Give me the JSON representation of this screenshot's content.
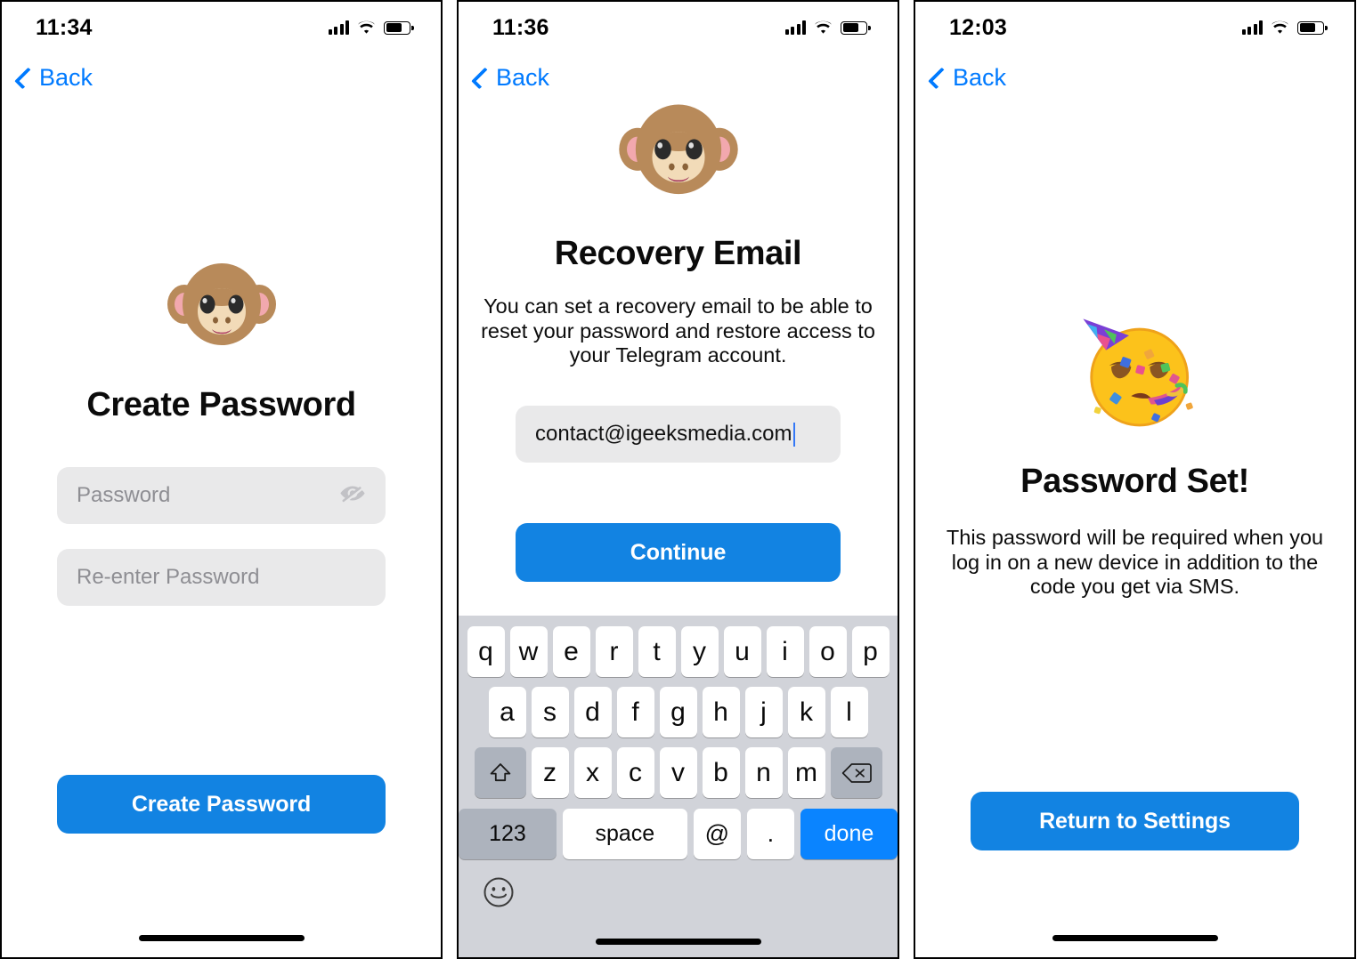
{
  "panels": [
    {
      "status": {
        "time": "11:34",
        "signal_icon": "cellular-signal-icon",
        "wifi_icon": "wifi-icon",
        "battery_icon": "battery-icon"
      },
      "back_label": "Back",
      "emoji": "monkey-face",
      "title": "Create Password",
      "fields": [
        {
          "name": "password-input",
          "placeholder": "Password",
          "value": "",
          "trailing_icon": "eye-slash-icon"
        },
        {
          "name": "reenter-password-input",
          "placeholder": "Re-enter Password",
          "value": "",
          "trailing_icon": ""
        }
      ],
      "button_label": "Create Password"
    },
    {
      "status": {
        "time": "11:36",
        "signal_icon": "cellular-signal-icon",
        "wifi_icon": "wifi-icon",
        "battery_icon": "battery-icon"
      },
      "back_label": "Back",
      "emoji": "monkey-face",
      "title": "Recovery Email",
      "subtitle": "You can set a recovery email to be able to reset your password and restore access to your Telegram account.",
      "email_value": "contact@igeeksmedia.com",
      "button_label": "Continue",
      "keyboard": {
        "row1": [
          "q",
          "w",
          "e",
          "r",
          "t",
          "y",
          "u",
          "i",
          "o",
          "p"
        ],
        "row2": [
          "a",
          "s",
          "d",
          "f",
          "g",
          "h",
          "j",
          "k",
          "l"
        ],
        "row3": [
          "z",
          "x",
          "c",
          "v",
          "b",
          "n",
          "m"
        ],
        "shift_icon": "shift-arrow-icon",
        "delete_icon": "backspace-icon",
        "numbers_label": "123",
        "space_label": "space",
        "at_label": "@",
        "dot_label": ".",
        "done_label": "done",
        "emoji_icon": "smiley-face-icon"
      }
    },
    {
      "status": {
        "time": "12:03",
        "signal_icon": "cellular-signal-icon",
        "wifi_icon": "wifi-icon",
        "battery_icon": "battery-icon"
      },
      "back_label": "Back",
      "emoji": "partying-face",
      "title": "Password Set!",
      "subtitle": "This password will be required when you log in on a new device in addition to the code you get via SMS.",
      "button_label": "Return to Settings"
    }
  ],
  "colors": {
    "accent_blue": "#1283e2",
    "link_blue": "#007AFF",
    "field_gray": "#e9e9ea",
    "placeholder_gray": "#8e8e93",
    "keyboard_bg": "#d1d3d9",
    "key_white": "#ffffff",
    "key_gray": "#adb3bd",
    "done_blue": "#0a84ff"
  }
}
